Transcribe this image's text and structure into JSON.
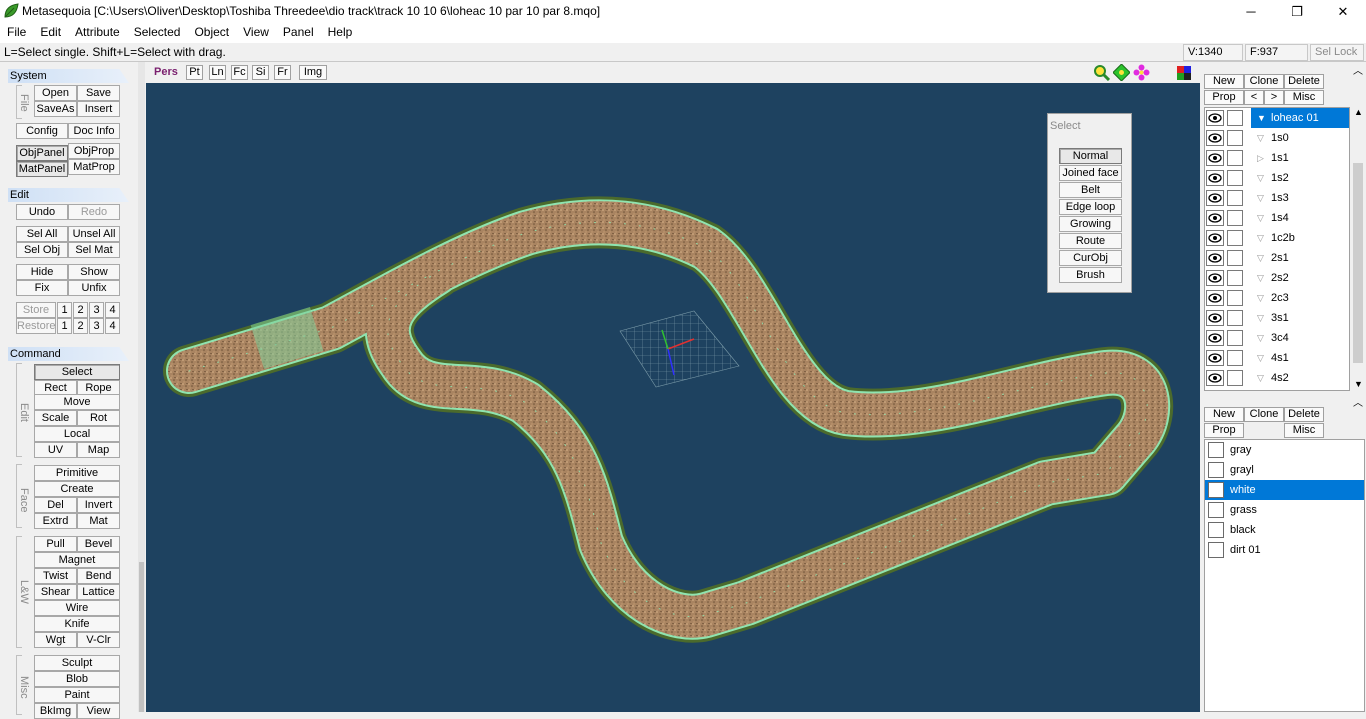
{
  "window": {
    "title": "Metasequoia [C:\\Users\\Oliver\\Desktop\\Toshiba Threedee\\dio track\\track 10 10 6\\loheac 10 par 10 par 8.mqo]",
    "minimize": "─",
    "maximize": "❐",
    "close": "✕"
  },
  "menu": [
    "File",
    "Edit",
    "Attribute",
    "Selected",
    "Object",
    "View",
    "Panel",
    "Help"
  ],
  "status": {
    "hint": "L=Select single.  Shift+L=Select with drag.",
    "vertices": "V:1340",
    "faces": "F:937",
    "sel_lock": "Sel Lock"
  },
  "left": {
    "system": {
      "header": "System",
      "file_label": "File",
      "open": "Open",
      "save": "Save",
      "saveas": "SaveAs",
      "insert": "Insert",
      "config": "Config",
      "docinfo": "Doc Info",
      "objpanel": "ObjPanel",
      "objprop": "ObjProp",
      "matpanel": "MatPanel",
      "matprop": "MatProp"
    },
    "edit": {
      "header": "Edit",
      "undo": "Undo",
      "redo": "Redo",
      "selall": "Sel All",
      "unselall": "Unsel All",
      "selobj": "Sel Obj",
      "selmat": "Sel Mat",
      "hide": "Hide",
      "show": "Show",
      "fix": "Fix",
      "unfix": "Unfix",
      "store": "Store",
      "restore": "Restore",
      "slots": [
        "1",
        "2",
        "3",
        "4"
      ]
    },
    "command": {
      "header": "Command",
      "edit_label": "Edit",
      "select": "Select",
      "rect": "Rect",
      "rope": "Rope",
      "move": "Move",
      "scale": "Scale",
      "rot": "Rot",
      "local": "Local",
      "uv": "UV",
      "map": "Map",
      "face_label": "Face",
      "primitive": "Primitive",
      "create": "Create",
      "del": "Del",
      "invert": "Invert",
      "extrd": "Extrd",
      "mat": "Mat",
      "lw_label": "L&W",
      "pull": "Pull",
      "bevel": "Bevel",
      "magnet": "Magnet",
      "twist": "Twist",
      "bend": "Bend",
      "shear": "Shear",
      "lattice": "Lattice",
      "wire": "Wire",
      "knife": "Knife",
      "wgt": "Wgt",
      "vclr": "V-Clr",
      "misc_label": "Misc",
      "sculpt": "Sculpt",
      "blob": "Blob",
      "paint": "Paint",
      "bkimg": "BkImg",
      "view": "View"
    }
  },
  "viewport": {
    "mode": "Pers",
    "buttons": [
      "Pt",
      "Ln",
      "Fc",
      "Si",
      "Fr"
    ],
    "img": "Img",
    "colors": {
      "background": "#1e4260",
      "track": "#b08a62",
      "edge": "#8fe4b0",
      "grass_border": "#5a7a3a"
    }
  },
  "select_panel": {
    "title": "Select",
    "options": [
      "Normal",
      "Joined face",
      "Belt",
      "Edge loop",
      "Growing",
      "Route",
      "CurObj",
      "Brush"
    ]
  },
  "objects_panel": {
    "new": "New",
    "clone": "Clone",
    "delete": "Delete",
    "prop": "Prop",
    "prev": "<",
    "next": ">",
    "misc": "Misc",
    "items": [
      {
        "name": "loheac 01",
        "icon": "triangle-down-icon",
        "selected": true
      },
      {
        "name": "1s0",
        "icon": "triangle-down-outline-icon"
      },
      {
        "name": "1s1",
        "icon": "triangle-right-outline-icon"
      },
      {
        "name": "1s2",
        "icon": "triangle-down-outline-icon"
      },
      {
        "name": "1s3",
        "icon": "triangle-down-outline-icon"
      },
      {
        "name": "1s4",
        "icon": "triangle-down-outline-icon"
      },
      {
        "name": "1c2b",
        "icon": "triangle-down-outline-icon"
      },
      {
        "name": "2s1",
        "icon": "triangle-down-outline-icon"
      },
      {
        "name": "2s2",
        "icon": "triangle-down-outline-icon"
      },
      {
        "name": "2c3",
        "icon": "triangle-down-outline-icon"
      },
      {
        "name": "3s1",
        "icon": "triangle-down-outline-icon"
      },
      {
        "name": "3c4",
        "icon": "triangle-down-outline-icon"
      },
      {
        "name": "4s1",
        "icon": "triangle-down-outline-icon"
      },
      {
        "name": "4s2",
        "icon": "triangle-down-outline-icon"
      }
    ]
  },
  "materials_panel": {
    "new": "New",
    "clone": "Clone",
    "delete": "Delete",
    "prop": "Prop",
    "misc": "Misc",
    "items": [
      {
        "name": "gray"
      },
      {
        "name": "grayl"
      },
      {
        "name": "white",
        "selected": true
      },
      {
        "name": "grass"
      },
      {
        "name": "black"
      },
      {
        "name": "dirt 01"
      }
    ]
  }
}
